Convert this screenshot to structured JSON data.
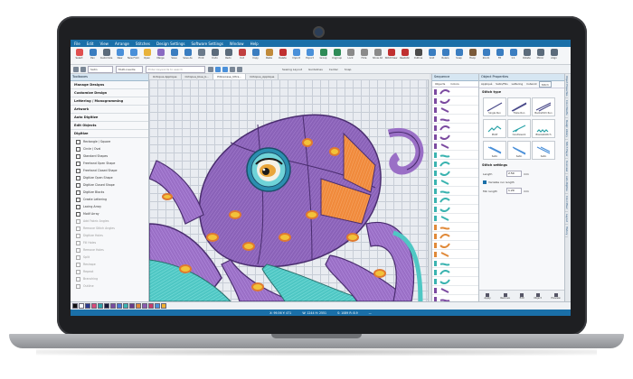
{
  "menu": [
    "File",
    "Edit",
    "View",
    "Arrange",
    "Stitches",
    "Design Settings",
    "Software Settings",
    "Window",
    "Help"
  ],
  "ribbon": [
    {
      "label": "Select",
      "color": "#e05050"
    },
    {
      "label": "Pan",
      "color": "#3a7dc0"
    },
    {
      "label": "Customize",
      "color": "#5b6b7b"
    },
    {
      "label": "New",
      "color": "#4a90d9"
    },
    {
      "label": "New From",
      "color": "#4a90d9"
    },
    {
      "label": "Open",
      "color": "#e8b23a"
    },
    {
      "label": "Merge",
      "color": "#8a6bc2"
    },
    {
      "label": "Save",
      "color": "#3a7dc0"
    },
    {
      "label": "Save As",
      "color": "#3a7dc0"
    },
    {
      "label": "Print",
      "color": "#6b7b8b"
    },
    {
      "label": "Undo",
      "color": "#5b6b7b"
    },
    {
      "label": "Redo",
      "color": "#5b6b7b"
    },
    {
      "label": "Cut",
      "color": "#c04040"
    },
    {
      "label": "Copy",
      "color": "#3a7dc0"
    },
    {
      "label": "Paste",
      "color": "#c08a3a"
    },
    {
      "label": "Delete",
      "color": "#c03030"
    },
    {
      "label": "Import",
      "color": "#4a90d9"
    },
    {
      "label": "Export",
      "color": "#4a90d9"
    },
    {
      "label": "Group",
      "color": "#2e8b57"
    },
    {
      "label": "Ungroup",
      "color": "#2e8b57"
    },
    {
      "label": "Lock",
      "color": "#8a8a8a"
    },
    {
      "label": "Hide",
      "color": "#8a8a8a"
    },
    {
      "label": "Show All",
      "color": "#8a8a8a"
    },
    {
      "label": "StitchView",
      "color": "#c03030"
    },
    {
      "label": "Realistic",
      "color": "#c03030"
    },
    {
      "label": "Outline",
      "color": "#4a4a4a"
    },
    {
      "label": "Grid",
      "color": "#3a7dc0"
    },
    {
      "label": "Rulers",
      "color": "#3a7dc0"
    },
    {
      "label": "Snap",
      "color": "#3a7dc0"
    },
    {
      "label": "Hoop",
      "color": "#7a5a3a"
    },
    {
      "label": "Zoom",
      "color": "#3a7dc0"
    },
    {
      "label": "Fit",
      "color": "#3a7dc0"
    },
    {
      "label": "1:1",
      "color": "#3a7dc0"
    },
    {
      "label": "Rotate",
      "color": "#5b6b7b"
    },
    {
      "label": "Mirror",
      "color": "#5b6b7b"
    },
    {
      "label": "Align",
      "color": "#5b6b7b"
    }
  ],
  "toolbar2": {
    "stitch_type": "Satin",
    "mode": "Multi-needle",
    "search_placeholder": "Enter keywords to search"
  },
  "toolbar2_buttons": [
    "Sewing Layout",
    "Guidelines",
    "Center",
    "Snap"
  ],
  "left_panel": {
    "title": "Toolboxes",
    "sections": [
      "Manage Designs",
      "Customize Design",
      "Lettering / Monogramming",
      "Artwork",
      "Auto Digitize",
      "Edit Objects",
      "Digitize"
    ],
    "items": [
      {
        "label": "Rectangle / Square",
        "enabled": true
      },
      {
        "label": "Circle / Oval",
        "enabled": true
      },
      {
        "label": "Standard Shapes",
        "enabled": true
      },
      {
        "label": "Freehand Open Shape",
        "enabled": true
      },
      {
        "label": "Freehand Closed Shape",
        "enabled": true
      },
      {
        "label": "Digitize Open Shape",
        "enabled": true
      },
      {
        "label": "Digitize Closed Shape",
        "enabled": true
      },
      {
        "label": "Digitize Blocks",
        "enabled": true
      },
      {
        "label": "Create Lettering",
        "enabled": true
      },
      {
        "label": "Lacing Array",
        "enabled": true
      },
      {
        "label": "Motif Array",
        "enabled": true
      },
      {
        "label": "Add Fabric Angles",
        "enabled": false
      },
      {
        "label": "Remove Stitch Angles",
        "enabled": false
      },
      {
        "label": "Digitize Holes",
        "enabled": false
      },
      {
        "label": "Fill Holes",
        "enabled": false
      },
      {
        "label": "Remove Holes",
        "enabled": false
      },
      {
        "label": "Split",
        "enabled": false
      },
      {
        "label": "Reshape",
        "enabled": false
      },
      {
        "label": "Repeat",
        "enabled": false
      },
      {
        "label": "Branching",
        "enabled": false
      },
      {
        "label": "Outline",
        "enabled": false
      }
    ]
  },
  "doc_tabs": [
    "Octopus Applique",
    "Octopus_blue_b...",
    "Pillowcase_Ultra...",
    "Octopus_Applique"
  ],
  "sequence": {
    "title": "Sequence",
    "tabs": [
      "Objects",
      "Colors"
    ],
    "rows": [
      {
        "color": "#7b4aa0"
      },
      {
        "color": "#7b4aa0"
      },
      {
        "color": "#7b4aa0"
      },
      {
        "color": "#7b4aa0"
      },
      {
        "color": "#7b4aa0"
      },
      {
        "color": "#7b4aa0"
      },
      {
        "color": "#7b4aa0"
      },
      {
        "color": "#3ab3b0"
      },
      {
        "color": "#3ab3b0"
      },
      {
        "color": "#3ab3b0"
      },
      {
        "color": "#3ab3b0"
      },
      {
        "color": "#3ab3b0"
      },
      {
        "color": "#3ab3b0"
      },
      {
        "color": "#3ab3b0"
      },
      {
        "color": "#3ab3b0"
      },
      {
        "color": "#e08a3a"
      },
      {
        "color": "#e08a3a"
      },
      {
        "color": "#e08a3a"
      },
      {
        "color": "#e08a3a"
      },
      {
        "color": "#3ab3b0"
      },
      {
        "color": "#3ab3b0"
      },
      {
        "color": "#3ab3b0"
      },
      {
        "color": "#7b4aa0"
      },
      {
        "color": "#7b4aa0"
      },
      {
        "color": "#7b4aa0"
      }
    ]
  },
  "properties": {
    "title": "Object Properties",
    "tabs": [
      "Appliqué",
      "Satin/Fills",
      "Lettering",
      "Cutwork",
      "Stitch"
    ],
    "stitch_type_title": "Stitch type",
    "stitch_types": [
      "Single Run",
      "Triple Run",
      "Backstitch Run",
      "Motif",
      "Candlewick",
      "Blanketstitch",
      "Satin",
      "Satin",
      "Satin"
    ],
    "settings_title": "Stitch settings",
    "length_label": "Length",
    "length_value": "2.50",
    "length_unit": "mm",
    "variable_label": "Variable run length",
    "minlength_label": "Min length",
    "minlength_value": "1.20",
    "minlength_unit": "mm",
    "actions": [
      "Apply",
      "Remove",
      "Edit",
      "Object",
      "Preview"
    ]
  },
  "vertical_tabs": [
    "Object Properties",
    "Color Palette",
    "Design Library",
    "Stitch Player",
    "Overview",
    "Auto-Digitize",
    "Color Mixer",
    "Layout",
    "History"
  ],
  "palette": [
    "#111111",
    "#ffffff",
    "#2b3a8f",
    "#d94a7a",
    "#2aa3a8",
    "#1c1c3a",
    "#7a4aa0",
    "#4a7ad9",
    "#3ab3b0",
    "#6a3a8a",
    "#e08a3a",
    "#8a5ab0",
    "#c83a6a",
    "#4a90d9",
    "#f0b030"
  ],
  "status": {
    "cursor": "X: 99.56 Y: 471",
    "dims": "W: 1244 H: 2551",
    "stitches": "S: 1089 R: 8.9",
    "extra": "—"
  },
  "art": {
    "bg_purple": "#8a62b8",
    "dark_purple": "#4a2d6f",
    "teal": "#4fc7c4",
    "orange": "#f08a3c",
    "yellow": "#f2c23a",
    "pink": "#e98a8a"
  }
}
